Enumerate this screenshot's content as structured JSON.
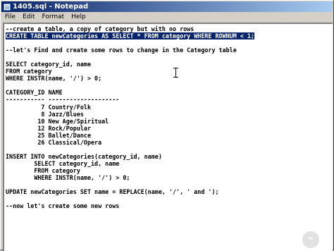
{
  "window": {
    "title": "1405.sql - Notepad"
  },
  "menu": {
    "items": [
      "File",
      "Edit",
      "Format",
      "Help"
    ]
  },
  "editor": {
    "lines": [
      "--create a table, a copy of category but with no rows",
      "CREATE TABLE newCategories AS SELECT * FROM category WHERE ROWNUM < 1;",
      "",
      "--let's Find and create some rows to change in the Category table",
      "",
      "SELECT category_id, name",
      "FROM category",
      "WHERE INSTR(name, '/') > 0;",
      "",
      "CATEGORY_ID NAME",
      "----------- --------------------",
      "          7 Country/Folk",
      "          8 Jazz/Blues",
      "         10 New Age/Spiritual",
      "         12 Rock/Popular",
      "         25 Ballet/Dance",
      "         26 Classical/Opera",
      "",
      "INSERT INTO newCategories(category_id, name)",
      "        SELECT category_id, name",
      "        FROM category",
      "        WHERE INSTR(name, '/') > 0;",
      "",
      "UPDATE newCategories SET name = REPLACE(name, '/', ' and ');",
      "",
      "--now let's create some new rows"
    ],
    "selected_line_index": 1
  }
}
